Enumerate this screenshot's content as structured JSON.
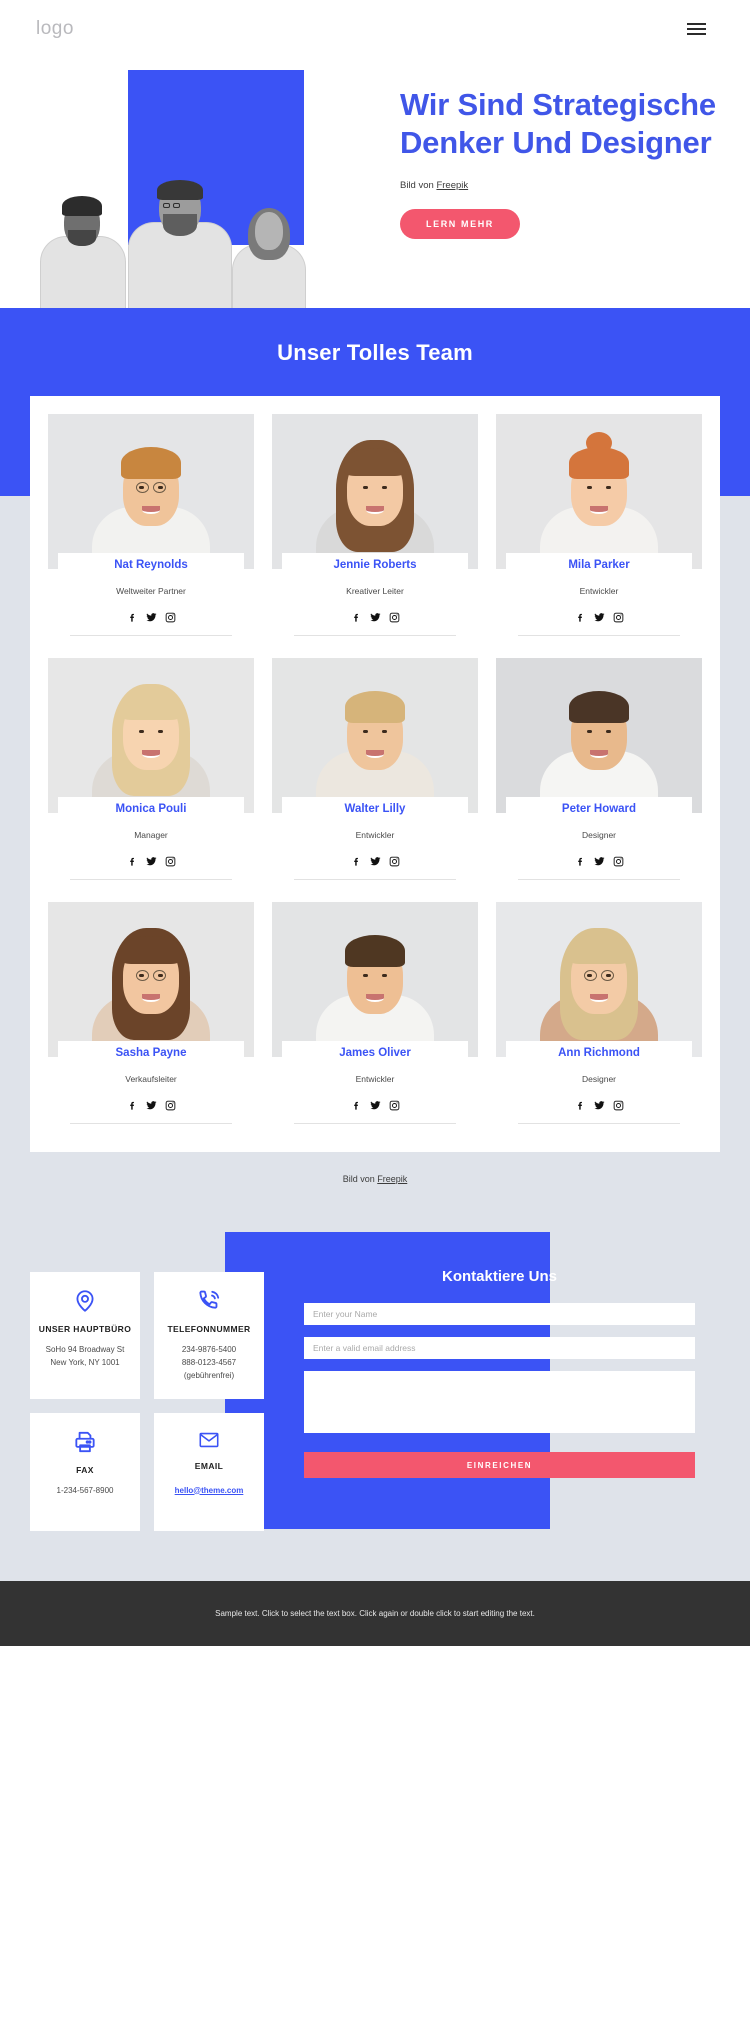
{
  "header": {
    "logo": "logo",
    "menu_icon": "hamburger-menu-icon"
  },
  "hero": {
    "title": "Wir Sind Strategische Denker Und Designer",
    "credit_prefix": "Bild von ",
    "credit_link": "Freepik",
    "cta_label": "LERN MEHR",
    "accent_blue": "#3b53f5",
    "accent_pink": "#f3576e"
  },
  "team": {
    "title": "Unser Tolles Team",
    "social_icons": [
      "facebook-icon",
      "twitter-icon",
      "instagram-icon"
    ],
    "members": [
      {
        "name": "Nat Reynolds",
        "role": "Weltweiter Partner"
      },
      {
        "name": "Jennie Roberts",
        "role": "Kreativer Leiter"
      },
      {
        "name": "Mila Parker",
        "role": "Entwickler"
      },
      {
        "name": "Monica Pouli",
        "role": "Manager"
      },
      {
        "name": "Walter Lilly",
        "role": "Entwickler"
      },
      {
        "name": "Peter Howard",
        "role": "Designer"
      },
      {
        "name": "Sasha Payne",
        "role": "Verkaufsleiter"
      },
      {
        "name": "James Oliver",
        "role": "Entwickler"
      },
      {
        "name": "Ann Richmond",
        "role": "Designer"
      }
    ]
  },
  "mid_credit": {
    "prefix": "Bild von ",
    "link": "Freepik"
  },
  "contact": {
    "cards": [
      {
        "icon": "location-pin-icon",
        "title": "UNSER HAUPTBÜRO",
        "lines": [
          "SoHo 94 Broadway St",
          "New York, NY 1001"
        ]
      },
      {
        "icon": "phone-icon",
        "title": "TELEFONNUMMER",
        "lines": [
          "234-9876-5400",
          "888-0123-4567",
          "(gebührenfrei)"
        ]
      },
      {
        "icon": "printer-icon",
        "title": "FAX",
        "lines": [
          "1-234-567-8900"
        ]
      },
      {
        "icon": "envelope-icon",
        "title": "EMAIL",
        "lines": [],
        "link": "hello@theme.com"
      }
    ],
    "form": {
      "title": "Kontaktiere Uns",
      "name_placeholder": "Enter your Name",
      "email_placeholder": "Enter a valid email address",
      "message_placeholder": "",
      "submit_label": "EINREICHEN"
    }
  },
  "footer": {
    "text": "Sample text. Click to select the text box. Click again or double click to start editing the text."
  }
}
